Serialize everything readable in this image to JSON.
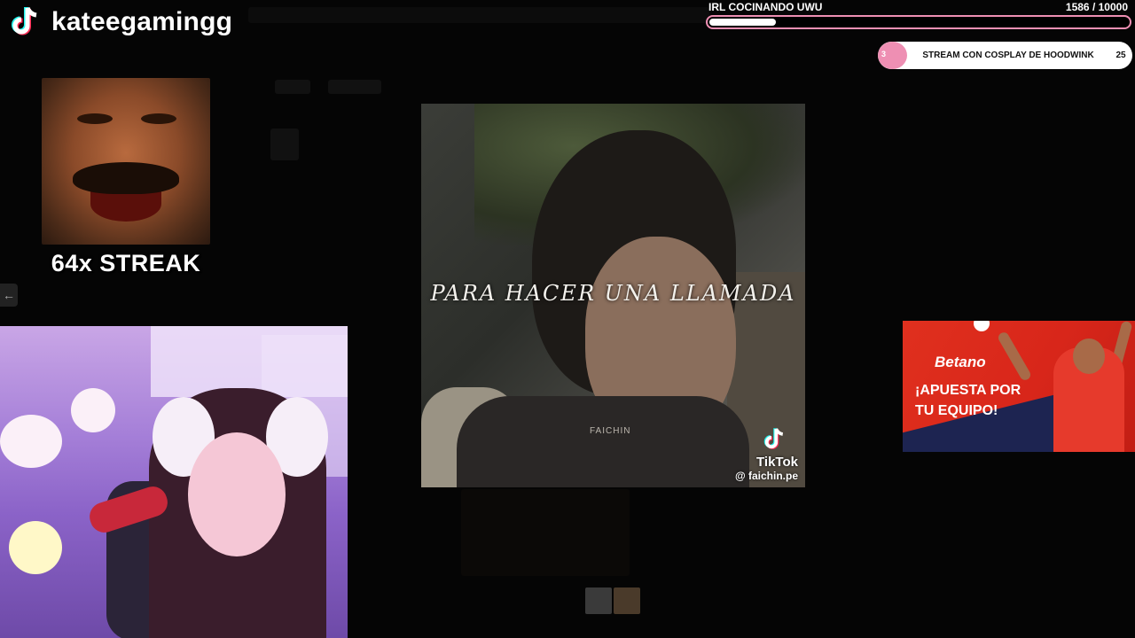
{
  "brand": {
    "name": "kateegamingg",
    "icon": "tiktok-logo-icon"
  },
  "streak": {
    "label": "64x STREAK"
  },
  "goal": {
    "title": "IRL COCINANDO UWU",
    "current": "1586",
    "target": "/ 10000",
    "progress": 0.1586
  },
  "cosplay_goal": {
    "count": "3",
    "text": "STREAM CON COSPLAY DE HOODWINK",
    "target": "25"
  },
  "video": {
    "caption": "PARA HACER UNA LLAMADA",
    "watermark": "FAICHIN",
    "platform": "TikTok",
    "handle": "@ faichin.pe"
  },
  "ad": {
    "brand": "Betano",
    "slogan": "¡APUESTA POR TU EQUIPO!"
  },
  "colors": {
    "accent_pink": "#ee8fb3",
    "ad_red": "#e0301e",
    "ad_navy": "#1d2451"
  }
}
